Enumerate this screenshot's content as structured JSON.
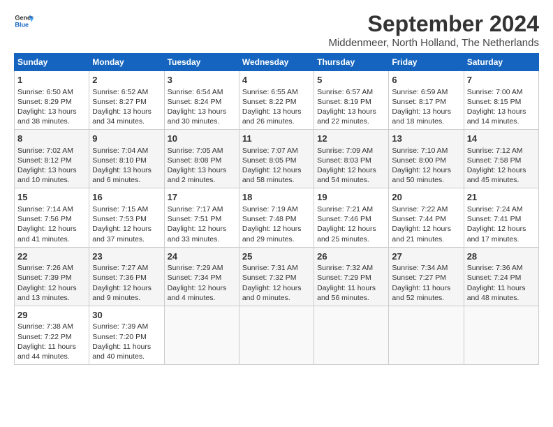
{
  "logo": {
    "line1": "General",
    "line2": "Blue"
  },
  "title": "September 2024",
  "location": "Middenmeer, North Holland, The Netherlands",
  "headers": [
    "Sunday",
    "Monday",
    "Tuesday",
    "Wednesday",
    "Thursday",
    "Friday",
    "Saturday"
  ],
  "weeks": [
    [
      {
        "day": "1",
        "sunrise": "6:50 AM",
        "sunset": "8:29 PM",
        "daylight": "13 hours and 38 minutes."
      },
      {
        "day": "2",
        "sunrise": "6:52 AM",
        "sunset": "8:27 PM",
        "daylight": "13 hours and 34 minutes."
      },
      {
        "day": "3",
        "sunrise": "6:54 AM",
        "sunset": "8:24 PM",
        "daylight": "13 hours and 30 minutes."
      },
      {
        "day": "4",
        "sunrise": "6:55 AM",
        "sunset": "8:22 PM",
        "daylight": "13 hours and 26 minutes."
      },
      {
        "day": "5",
        "sunrise": "6:57 AM",
        "sunset": "8:19 PM",
        "daylight": "13 hours and 22 minutes."
      },
      {
        "day": "6",
        "sunrise": "6:59 AM",
        "sunset": "8:17 PM",
        "daylight": "13 hours and 18 minutes."
      },
      {
        "day": "7",
        "sunrise": "7:00 AM",
        "sunset": "8:15 PM",
        "daylight": "13 hours and 14 minutes."
      }
    ],
    [
      {
        "day": "8",
        "sunrise": "7:02 AM",
        "sunset": "8:12 PM",
        "daylight": "13 hours and 10 minutes."
      },
      {
        "day": "9",
        "sunrise": "7:04 AM",
        "sunset": "8:10 PM",
        "daylight": "13 hours and 6 minutes."
      },
      {
        "day": "10",
        "sunrise": "7:05 AM",
        "sunset": "8:08 PM",
        "daylight": "13 hours and 2 minutes."
      },
      {
        "day": "11",
        "sunrise": "7:07 AM",
        "sunset": "8:05 PM",
        "daylight": "12 hours and 58 minutes."
      },
      {
        "day": "12",
        "sunrise": "7:09 AM",
        "sunset": "8:03 PM",
        "daylight": "12 hours and 54 minutes."
      },
      {
        "day": "13",
        "sunrise": "7:10 AM",
        "sunset": "8:00 PM",
        "daylight": "12 hours and 50 minutes."
      },
      {
        "day": "14",
        "sunrise": "7:12 AM",
        "sunset": "7:58 PM",
        "daylight": "12 hours and 45 minutes."
      }
    ],
    [
      {
        "day": "15",
        "sunrise": "7:14 AM",
        "sunset": "7:56 PM",
        "daylight": "12 hours and 41 minutes."
      },
      {
        "day": "16",
        "sunrise": "7:15 AM",
        "sunset": "7:53 PM",
        "daylight": "12 hours and 37 minutes."
      },
      {
        "day": "17",
        "sunrise": "7:17 AM",
        "sunset": "7:51 PM",
        "daylight": "12 hours and 33 minutes."
      },
      {
        "day": "18",
        "sunrise": "7:19 AM",
        "sunset": "7:48 PM",
        "daylight": "12 hours and 29 minutes."
      },
      {
        "day": "19",
        "sunrise": "7:21 AM",
        "sunset": "7:46 PM",
        "daylight": "12 hours and 25 minutes."
      },
      {
        "day": "20",
        "sunrise": "7:22 AM",
        "sunset": "7:44 PM",
        "daylight": "12 hours and 21 minutes."
      },
      {
        "day": "21",
        "sunrise": "7:24 AM",
        "sunset": "7:41 PM",
        "daylight": "12 hours and 17 minutes."
      }
    ],
    [
      {
        "day": "22",
        "sunrise": "7:26 AM",
        "sunset": "7:39 PM",
        "daylight": "12 hours and 13 minutes."
      },
      {
        "day": "23",
        "sunrise": "7:27 AM",
        "sunset": "7:36 PM",
        "daylight": "12 hours and 9 minutes."
      },
      {
        "day": "24",
        "sunrise": "7:29 AM",
        "sunset": "7:34 PM",
        "daylight": "12 hours and 4 minutes."
      },
      {
        "day": "25",
        "sunrise": "7:31 AM",
        "sunset": "7:32 PM",
        "daylight": "12 hours and 0 minutes."
      },
      {
        "day": "26",
        "sunrise": "7:32 AM",
        "sunset": "7:29 PM",
        "daylight": "11 hours and 56 minutes."
      },
      {
        "day": "27",
        "sunrise": "7:34 AM",
        "sunset": "7:27 PM",
        "daylight": "11 hours and 52 minutes."
      },
      {
        "day": "28",
        "sunrise": "7:36 AM",
        "sunset": "7:24 PM",
        "daylight": "11 hours and 48 minutes."
      }
    ],
    [
      {
        "day": "29",
        "sunrise": "7:38 AM",
        "sunset": "7:22 PM",
        "daylight": "11 hours and 44 minutes."
      },
      {
        "day": "30",
        "sunrise": "7:39 AM",
        "sunset": "7:20 PM",
        "daylight": "11 hours and 40 minutes."
      },
      null,
      null,
      null,
      null,
      null
    ]
  ]
}
